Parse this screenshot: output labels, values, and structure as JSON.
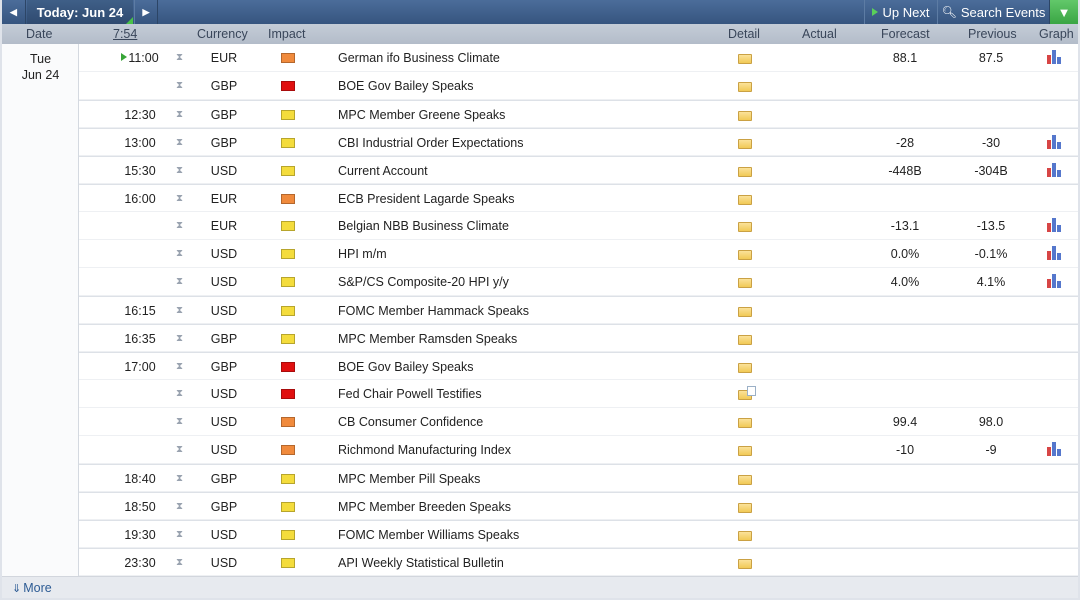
{
  "nav": {
    "prev_icon": "◀",
    "today_label": "Today: Jun 24",
    "next_icon": "▶",
    "up_next_label": "Up Next",
    "search_label": "Search Events",
    "filter_icon": "▼"
  },
  "columns": {
    "date": "Date",
    "time": "7:54",
    "currency": "Currency",
    "impact": "Impact",
    "detail": "Detail",
    "actual": "Actual",
    "forecast": "Forecast",
    "previous": "Previous",
    "graph": "Graph"
  },
  "date": {
    "weekday": "Tue",
    "day": "Jun 24"
  },
  "impact_colors": {
    "high": "#e01010",
    "medium": "#f08a3c",
    "low": "#f4dc3c"
  },
  "events": [
    {
      "time": "11:00",
      "current": true,
      "currency": "EUR",
      "impact": "medium",
      "title": "German ifo Business Climate",
      "actual": "",
      "forecast": "88.1",
      "previous": "87.5",
      "graph": true
    },
    {
      "time": "",
      "currency": "GBP",
      "impact": "high",
      "title": "BOE Gov Bailey Speaks",
      "actual": "",
      "forecast": "",
      "previous": "",
      "graph": false
    },
    {
      "time": "12:30",
      "currency": "GBP",
      "impact": "low",
      "title": "MPC Member Greene Speaks",
      "actual": "",
      "forecast": "",
      "previous": "",
      "graph": false
    },
    {
      "time": "13:00",
      "currency": "GBP",
      "impact": "low",
      "title": "CBI Industrial Order Expectations",
      "actual": "",
      "forecast": "-28",
      "previous": "-30",
      "graph": true
    },
    {
      "time": "15:30",
      "currency": "USD",
      "impact": "low",
      "title": "Current Account",
      "actual": "",
      "forecast": "-448B",
      "previous": "-304B",
      "graph": true
    },
    {
      "time": "16:00",
      "currency": "EUR",
      "impact": "medium",
      "title": "ECB President Lagarde Speaks",
      "actual": "",
      "forecast": "",
      "previous": "",
      "graph": false
    },
    {
      "time": "",
      "currency": "EUR",
      "impact": "low",
      "title": "Belgian NBB Business Climate",
      "actual": "",
      "forecast": "-13.1",
      "previous": "-13.5",
      "graph": true
    },
    {
      "time": "",
      "currency": "USD",
      "impact": "low",
      "title": "HPI m/m",
      "actual": "",
      "forecast": "0.0%",
      "previous": "-0.1%",
      "graph": true
    },
    {
      "time": "",
      "currency": "USD",
      "impact": "low",
      "title": "S&P/CS Composite-20 HPI y/y",
      "actual": "",
      "forecast": "4.0%",
      "previous": "4.1%",
      "graph": true
    },
    {
      "time": "16:15",
      "currency": "USD",
      "impact": "low",
      "title": "FOMC Member Hammack Speaks",
      "actual": "",
      "forecast": "",
      "previous": "",
      "graph": false
    },
    {
      "time": "16:35",
      "currency": "GBP",
      "impact": "low",
      "title": "MPC Member Ramsden Speaks",
      "actual": "",
      "forecast": "",
      "previous": "",
      "graph": false
    },
    {
      "time": "17:00",
      "currency": "GBP",
      "impact": "high",
      "title": "BOE Gov Bailey Speaks",
      "actual": "",
      "forecast": "",
      "previous": "",
      "graph": false
    },
    {
      "time": "",
      "currency": "USD",
      "impact": "high",
      "title": "Fed Chair Powell Testifies",
      "actual": "",
      "forecast": "",
      "previous": "",
      "graph": false,
      "detail_note": true
    },
    {
      "time": "",
      "currency": "USD",
      "impact": "medium",
      "title": "CB Consumer Confidence",
      "actual": "",
      "forecast": "99.4",
      "previous": "98.0",
      "graph": false
    },
    {
      "time": "",
      "currency": "USD",
      "impact": "medium",
      "title": "Richmond Manufacturing Index",
      "actual": "",
      "forecast": "-10",
      "previous": "-9",
      "graph": true
    },
    {
      "time": "18:40",
      "currency": "GBP",
      "impact": "low",
      "title": "MPC Member Pill Speaks",
      "actual": "",
      "forecast": "",
      "previous": "",
      "graph": false
    },
    {
      "time": "18:50",
      "currency": "GBP",
      "impact": "low",
      "title": "MPC Member Breeden Speaks",
      "actual": "",
      "forecast": "",
      "previous": "",
      "graph": false
    },
    {
      "time": "19:30",
      "currency": "USD",
      "impact": "low",
      "title": "FOMC Member Williams Speaks",
      "actual": "",
      "forecast": "",
      "previous": "",
      "graph": false
    },
    {
      "time": "23:30",
      "currency": "USD",
      "impact": "low",
      "title": "API Weekly Statistical Bulletin",
      "actual": "",
      "forecast": "",
      "previous": "",
      "graph": false
    }
  ],
  "footer": {
    "more_label": "More",
    "more_icon": "⇓"
  }
}
